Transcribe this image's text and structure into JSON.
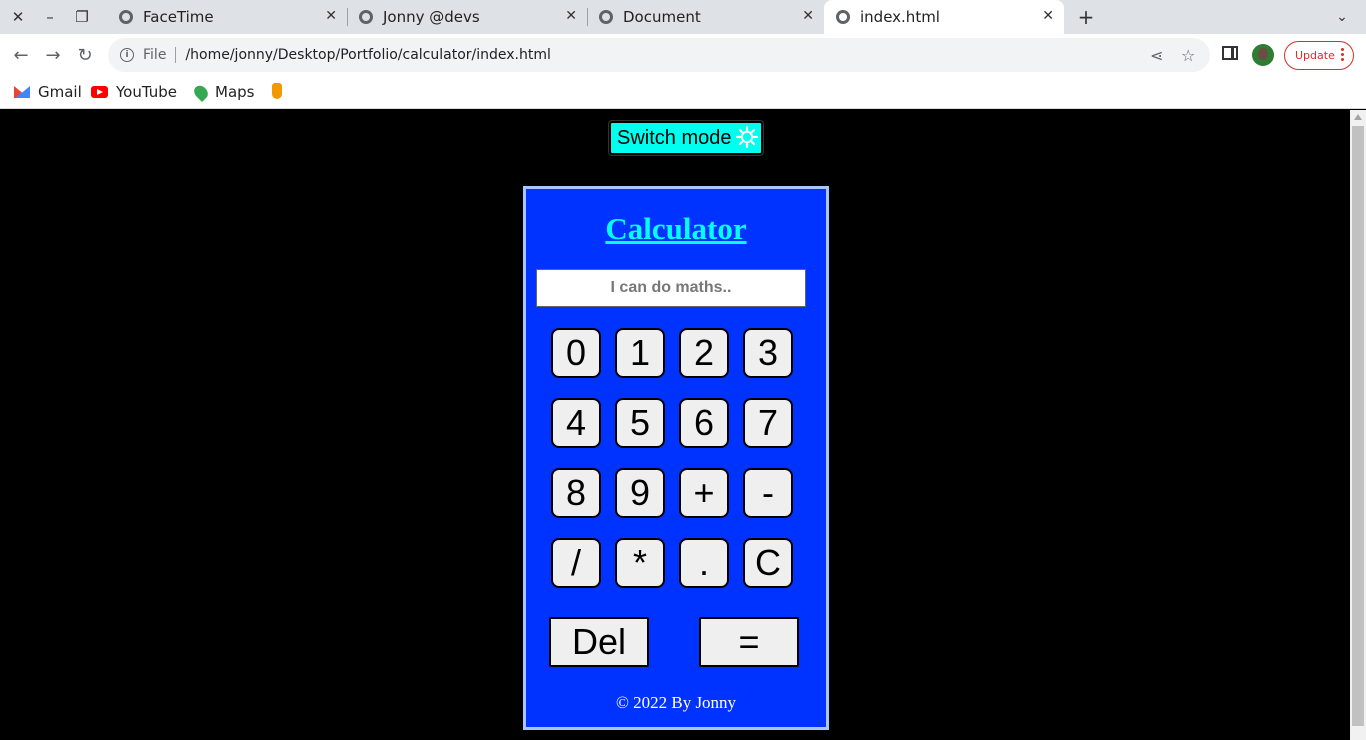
{
  "window": {
    "close_icon": "✕",
    "minimize_icon": "–",
    "restore_icon": "❐"
  },
  "tabs": [
    {
      "title": "FaceTime"
    },
    {
      "title": "Jonny @devs"
    },
    {
      "title": "Document"
    },
    {
      "title": "index.html"
    }
  ],
  "toolbar": {
    "scheme": "File",
    "url": "/home/jonny/Desktop/Portfolio/calculator/index.html",
    "update_label": "Update"
  },
  "bookmarks": [
    {
      "label": "Gmail"
    },
    {
      "label": "YouTube"
    },
    {
      "label": "Maps"
    }
  ],
  "page": {
    "switch_label": "Switch mode",
    "title": "Calculator",
    "display_placeholder": "I can do maths..",
    "keys": [
      "0",
      "1",
      "2",
      "3",
      "4",
      "5",
      "6",
      "7",
      "8",
      "9",
      "+",
      "-",
      "/",
      "*",
      ".",
      "C"
    ],
    "del_label": "Del",
    "equals_label": "=",
    "footer": "© 2022 By Jonny"
  },
  "colors": {
    "calc_bg": "#0033ff",
    "title_color": "#00ffff",
    "switch_bg": "#00ffee",
    "page_bg": "#000000"
  }
}
